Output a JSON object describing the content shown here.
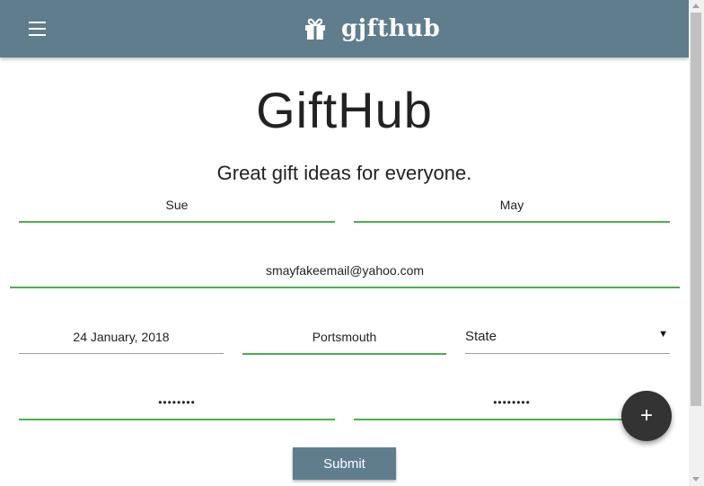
{
  "header": {
    "brand_name": "gjfthub",
    "menu_icon": "menu-icon",
    "brand_icon": "gift-icon",
    "background_color": "#5f7d8d"
  },
  "main": {
    "title": "GiftHub",
    "subtitle": "Great gift ideas for everyone."
  },
  "form": {
    "first_name": "Sue",
    "last_name": "May",
    "email": "smayfakeemail@yahoo.com",
    "date": "24 January, 2018",
    "city": "Portsmouth",
    "state_selected": "State",
    "password": "••••••••",
    "password_confirm": "••••••••",
    "submit_label": "Submit",
    "accent_color": "#4caf50"
  },
  "fab": {
    "icon": "plus-icon",
    "label": "+"
  }
}
